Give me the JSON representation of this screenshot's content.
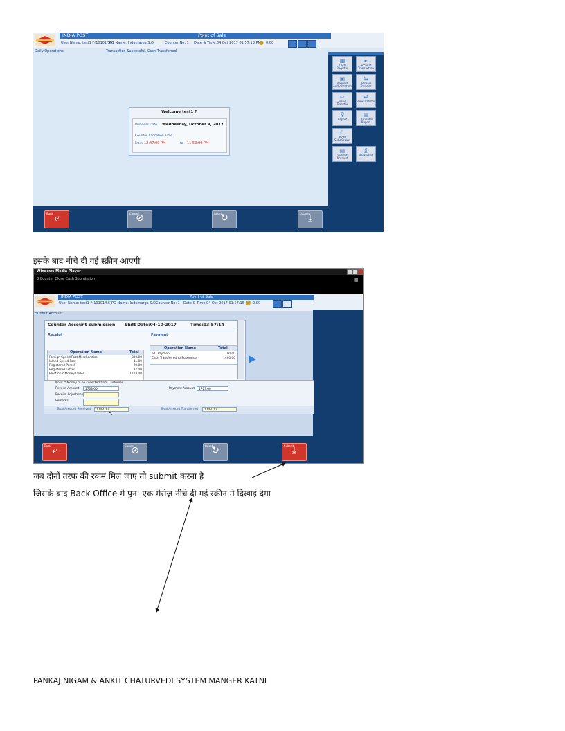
{
  "screen1": {
    "app_name": "INDIA POST",
    "title": "Point of Sale",
    "user_name": "User Name: test1 F(10101/55)",
    "po_name": "PO Name: Indumarga S.O",
    "counter": "Counter No: 1",
    "datetime": "Date & Time:04 Oct 2017 01:57:13 PM",
    "amount": "0.00",
    "section": "Daily Operations",
    "status_message": "Transaction Successful. Cash Transferred",
    "welcome": {
      "heading": "Welcome test1 F",
      "business_date_label": "Business Date",
      "business_date": "Wednesday, October 4, 2017",
      "allocation_label": "Counter Allocation Time",
      "from_label": "From",
      "from_time": "12:47:00 PM",
      "to_label": "to",
      "to_time": "11:50:00 PM"
    },
    "function_keys": [
      {
        "label": "Cash Register",
        "icon": "register-icon"
      },
      {
        "label": "Account Transaction",
        "icon": "account-icon"
      },
      {
        "label": "Request Authorization",
        "icon": "request-icon"
      },
      {
        "label": "Receive Transfer",
        "icon": "receive-icon"
      },
      {
        "label": "Issue Transfer",
        "icon": "issue-icon"
      },
      {
        "label": "View Transfer",
        "icon": "view-icon"
      },
      {
        "label": "Report",
        "icon": "report-icon"
      },
      {
        "label": "Calculator Report",
        "icon": "calculator-icon"
      },
      {
        "label": "Night Submission",
        "icon": "night-icon"
      },
      {
        "label": "Submit Account",
        "icon": "submit-icon"
      },
      {
        "label": "Back Print",
        "icon": "print-icon"
      }
    ],
    "bottom_buttons": [
      {
        "label": "Back",
        "icon": "back-arrow-icon"
      },
      {
        "label": "Cancel",
        "icon": "cancel-icon"
      },
      {
        "label": "Reset",
        "icon": "reset-icon"
      },
      {
        "label": "Submit",
        "icon": "download-icon"
      }
    ]
  },
  "caption1": "इसके बाद नीचे दी गई स्क्रीन आएगी",
  "screen2": {
    "window_title": "Windows Media Player",
    "window_subtitle": "3 Counter Close Cash Submission",
    "app_name": "INDIA POST",
    "title": "Point of Sale",
    "user_name": "User Name: test1 F(10101/55)",
    "po_name": "PO Name: Indumarga S.O",
    "counter": "Counter No: 1",
    "datetime": "Date & Time:04 Oct 2017 01:57:15 PM",
    "amount": "0.00",
    "section": "Submit Account",
    "sheet_title": "Counter Account Submission",
    "shift_date": "Shift Date:04-10-2017",
    "time": "Time:13:57:14",
    "receipt_label": "Receipt",
    "payment_label": "Payment",
    "receipt_headers": [
      "Operation Name",
      "Total"
    ],
    "receipt_rows": [
      [
        "Foreign Speed Post Merchandise",
        "800.00"
      ],
      [
        "Inland Speed Post",
        "41.00"
      ],
      [
        "Registered Parcel",
        "20.00"
      ],
      [
        "Registered Letter",
        "37.00"
      ],
      [
        "Electronic Money Order",
        "1103.00"
      ]
    ],
    "payment_headers": [
      "Operation Name",
      "Total"
    ],
    "payment_rows": [
      [
        "IPO Payment",
        "00.00"
      ],
      [
        "Cash Transferred to Supervisor",
        "1460.00"
      ]
    ],
    "note": "Note: * Money to be collected from Customer",
    "receipt_amount_label": "Receipt Amount",
    "receipt_amount": "1703.00",
    "receipt_adjustment_label": "Receipt Adjustment",
    "remarks_label": "Remarks",
    "payment_amount_label": "Payment Amount",
    "payment_amount": "1703.00",
    "total_received_label": "Total Amount Received",
    "total_received": "1703.00",
    "total_transferred_label": "Total Amount Transferred",
    "total_transferred": "1703.00"
  },
  "caption2": "जब दोनों तरफ की रकम मिल जाए तो submit करना है",
  "caption3": "जिसके बाद Back Office मे पुन: एक मेसेज़ नीचे दी गई स्क्रीन मे दिखाई देगा",
  "footer": "PANKAJ NIGAM & ANKIT CHATURVEDI SYSTEM MANGER KATNI",
  "colors": {
    "header_blue": "#2f6fc0",
    "panel_navy": "#123d6e",
    "action_red": "#d0362b",
    "screen_bg": "#dbe8f5"
  }
}
